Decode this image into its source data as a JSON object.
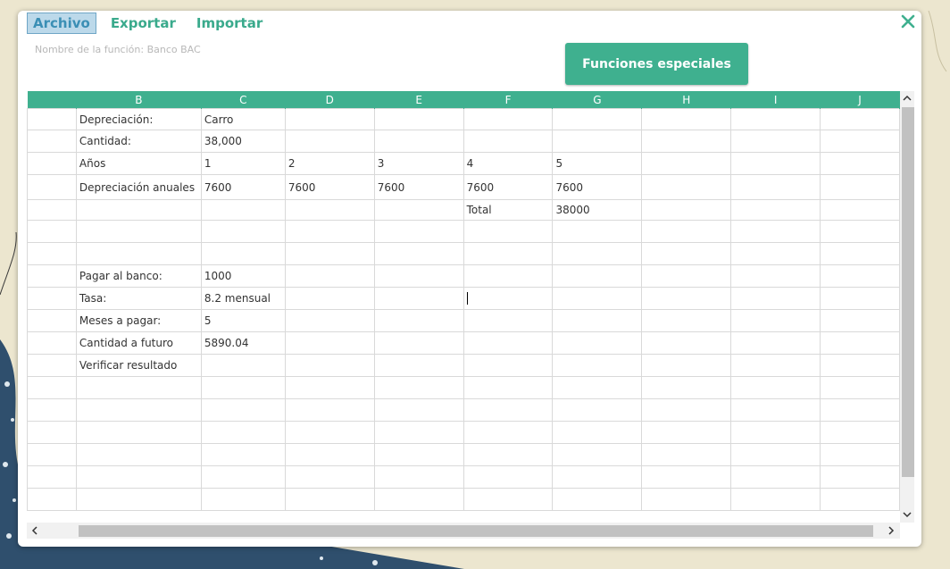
{
  "menu": {
    "archivo": "Archivo",
    "exportar": "Exportar",
    "importar": "Importar"
  },
  "function_name": "Nombre de la función: Banco BAC",
  "special_button": "Funciones especiales",
  "colors": {
    "accent": "#3fb08f",
    "menu_active_bg": "#bcd9ea",
    "text": "#333333"
  },
  "columns": [
    "",
    "B",
    "C",
    "D",
    "E",
    "F",
    "G",
    "H",
    "I",
    "J"
  ],
  "rows": [
    [
      "",
      "Depreciación:",
      "Carro",
      "",
      "",
      "",
      "",
      "",
      "",
      ""
    ],
    [
      "",
      "Cantidad:",
      "38,000",
      "",
      "",
      "",
      "",
      "",
      "",
      ""
    ],
    [
      "",
      "Años",
      "1",
      "2",
      "3",
      "4",
      "5",
      "",
      "",
      ""
    ],
    [
      "",
      "Depreciación anuales",
      "7600",
      "7600",
      "7600",
      "7600",
      "7600",
      "",
      "",
      ""
    ],
    [
      "",
      "",
      "",
      "",
      "",
      "Total",
      "38000",
      "",
      "",
      ""
    ],
    [
      "",
      "",
      "",
      "",
      "",
      "",
      "",
      "",
      "",
      ""
    ],
    [
      "",
      "",
      "",
      "",
      "",
      "",
      "",
      "",
      "",
      ""
    ],
    [
      "",
      "Pagar al banco:",
      "1000",
      "",
      "",
      "",
      "",
      "",
      "",
      ""
    ],
    [
      "",
      "Tasa:",
      "8.2 mensual",
      "",
      "",
      "",
      "",
      "",
      "",
      ""
    ],
    [
      "",
      "Meses a pagar:",
      "5",
      "",
      "",
      "",
      "",
      "",
      "",
      ""
    ],
    [
      "",
      "Cantidad a futuro",
      "5890.04",
      "",
      "",
      "",
      "",
      "",
      "",
      ""
    ],
    [
      "",
      "Verificar resultado",
      "",
      "",
      "",
      "",
      "",
      "",
      "",
      ""
    ],
    [
      "",
      "",
      "",
      "",
      "",
      "",
      "",
      "",
      "",
      ""
    ],
    [
      "",
      "",
      "",
      "",
      "",
      "",
      "",
      "",
      "",
      ""
    ],
    [
      "",
      "",
      "",
      "",
      "",
      "",
      "",
      "",
      "",
      ""
    ],
    [
      "",
      "",
      "",
      "",
      "",
      "",
      "",
      "",
      "",
      ""
    ],
    [
      "",
      "",
      "",
      "",
      "",
      "",
      "",
      "",
      "",
      ""
    ],
    [
      "",
      "",
      "",
      "",
      "",
      "",
      "",
      "",
      "",
      ""
    ]
  ],
  "icons": {
    "close": "close-icon",
    "scroll_up": "chevron-up-icon",
    "scroll_down": "chevron-down-icon",
    "scroll_left": "chevron-left-icon",
    "scroll_right": "chevron-right-icon"
  }
}
